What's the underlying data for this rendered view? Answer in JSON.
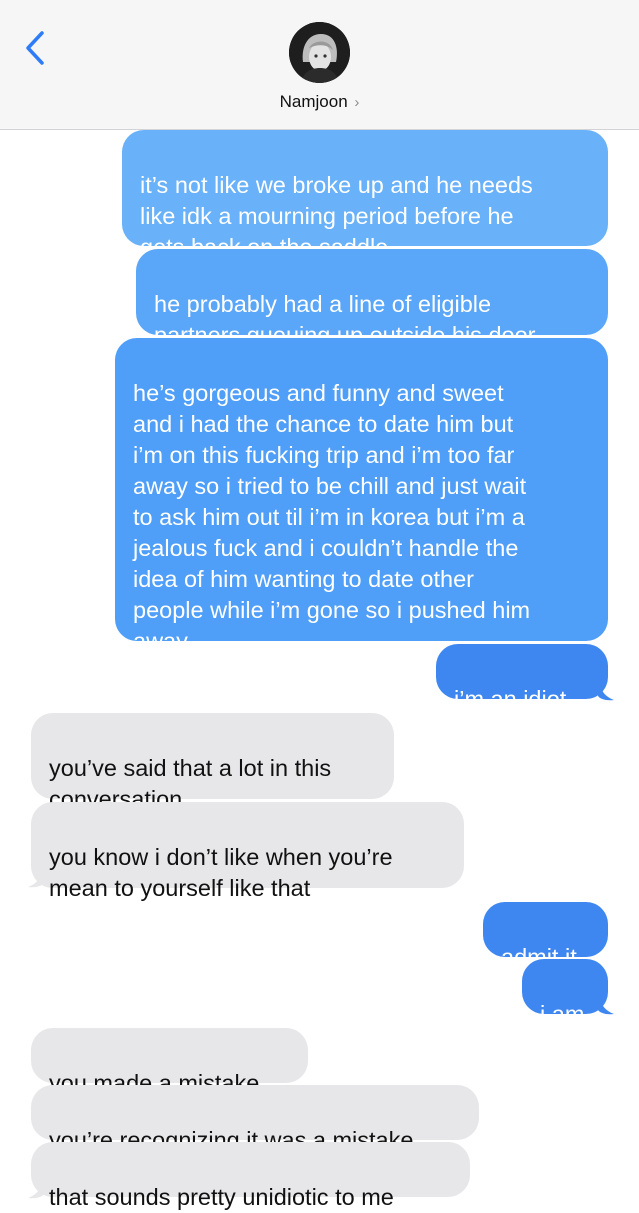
{
  "header": {
    "contact_name": "Namjoon",
    "chevron": "›"
  },
  "messages": [
    {
      "side": "sent",
      "text": "it’s not like we broke up and he needs\nlike idk a mourning period before he\ngets back on the saddle"
    },
    {
      "side": "sent",
      "text": "he probably had a line of eligible\npartners queuing up outside his door"
    },
    {
      "side": "sent",
      "text": "he’s gorgeous and funny and sweet\nand i had the chance to date him but\ni’m on this fucking trip and i’m too far\naway so i tried to be chill and just wait\nto ask him out til i’m in korea but i’m a\njealous fuck and i couldn’t handle the\nidea of him wanting to date other\npeople while i’m gone so i pushed him\naway"
    },
    {
      "side": "sent",
      "text": "i’m an idiot"
    },
    {
      "side": "received",
      "text": "you’ve said that a lot in this\nconversation"
    },
    {
      "side": "received",
      "text": "you know i don’t like when you’re\nmean to yourself like that"
    },
    {
      "side": "sent",
      "text": "admit it"
    },
    {
      "side": "sent",
      "text": "i am"
    },
    {
      "side": "received",
      "text": "you made a mistake"
    },
    {
      "side": "received",
      "text": "you’re recognizing it was a mistake"
    },
    {
      "side": "received",
      "text": "that sounds pretty unidiotic to me"
    }
  ],
  "colors": {
    "sent_bubble": "#4f9ef7",
    "received_bubble": "#e7e7ea",
    "back_arrow": "#2f7df6"
  }
}
